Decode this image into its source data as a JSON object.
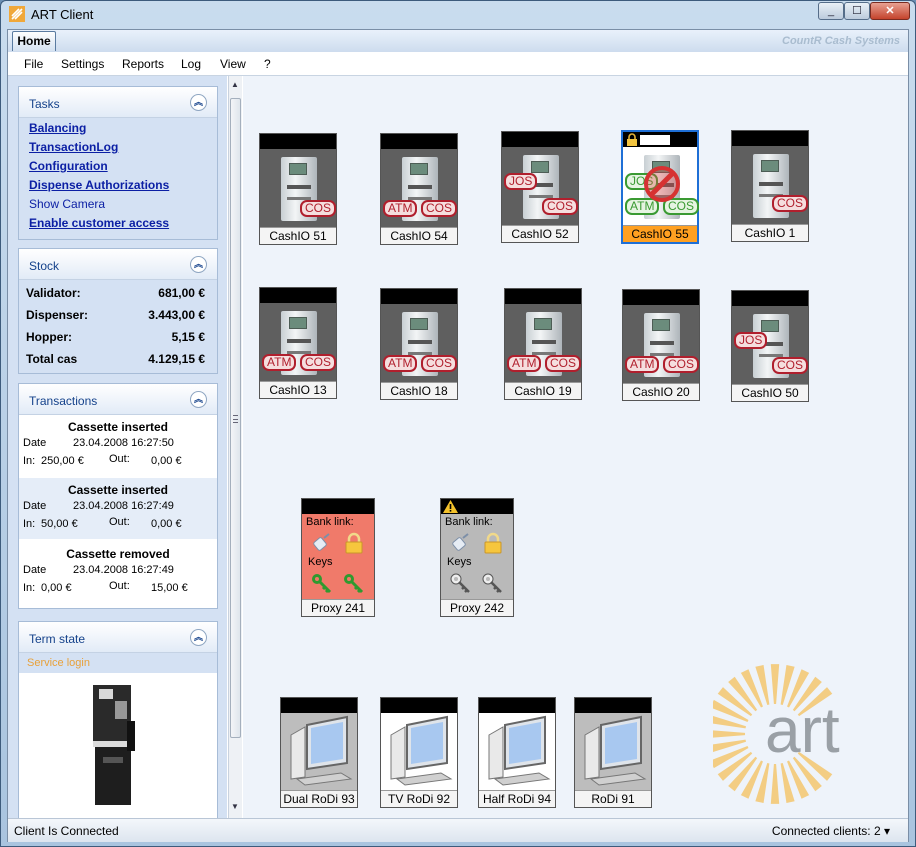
{
  "window": {
    "title": "ART Client",
    "min": "_",
    "max": "☐",
    "close": "✕"
  },
  "ribbon": {
    "home_tab": "Home",
    "brand": "CountR Cash Systems"
  },
  "menu": [
    "File",
    "Settings",
    "Reports",
    "Log",
    "View",
    "?"
  ],
  "tasks": {
    "title": "Tasks",
    "collapse": "︽",
    "items": [
      {
        "label": "Balancing",
        "style": "link"
      },
      {
        "label": "TransactionLog",
        "style": "link"
      },
      {
        "label": "Configuration",
        "style": "link"
      },
      {
        "label": "Dispense Authorizations",
        "style": "link"
      },
      {
        "label": "Show Camera",
        "style": "plain"
      },
      {
        "label": "Enable customer access",
        "style": "link"
      }
    ]
  },
  "stock": {
    "title": "Stock",
    "collapse": "︽",
    "rows": [
      {
        "label": "Validator:",
        "value": "681,00 €"
      },
      {
        "label": "Dispenser:",
        "value": "3.443,00 €"
      },
      {
        "label": "Hopper:",
        "value": "5,15 €"
      },
      {
        "label": "Total cas",
        "value": "4.129,15 €"
      }
    ]
  },
  "transactions": {
    "title": "Transactions",
    "collapse": "︽",
    "date_label": "Date",
    "in_label": "In:",
    "out_label": "Out:",
    "items": [
      {
        "title": "Cassette inserted",
        "date": "23.04.2008 16:27:50",
        "in": "250,00 €",
        "out": "0,00 €"
      },
      {
        "title": "Cassette inserted",
        "date": "23.04.2008 16:27:49",
        "in": "50,00 €",
        "out": "0,00 €"
      },
      {
        "title": "Cassette removed",
        "date": "23.04.2008 16:27:49",
        "in": "0,00 €",
        "out": "15,00 €"
      }
    ]
  },
  "term_state": {
    "title": "Term state",
    "collapse": "︽",
    "service_login": "Service login"
  },
  "tiles_row1": [
    {
      "label": "CashIO 51",
      "badges": [
        "COS"
      ]
    },
    {
      "label": "CashIO 54",
      "badges": [
        "ATM",
        "COS"
      ]
    },
    {
      "label": "CashIO 52",
      "badges": [
        "JOS",
        "COS"
      ]
    },
    {
      "label": "CashIO 55",
      "badges": [
        "JOS",
        "ATM",
        "COS"
      ],
      "selected": true
    },
    {
      "label": "CashIO 1",
      "badges": [
        "COS"
      ]
    }
  ],
  "tiles_row2": [
    {
      "label": "CashIO 13",
      "badges": [
        "ATM",
        "COS"
      ]
    },
    {
      "label": "CashIO 18",
      "badges": [
        "ATM",
        "COS"
      ]
    },
    {
      "label": "CashIO 19",
      "badges": [
        "ATM",
        "COS"
      ]
    },
    {
      "label": "CashIO 20",
      "badges": [
        "ATM",
        "COS"
      ]
    },
    {
      "label": "CashIO 50",
      "badges": [
        "JOS",
        "COS"
      ]
    }
  ],
  "proxies": [
    {
      "label": "Proxy 241",
      "bank_link": "Bank link:",
      "keys": "Keys",
      "status_color": "#f07a6a"
    },
    {
      "label": "Proxy 242",
      "bank_link": "Bank link:",
      "keys": "Keys",
      "status_color": "#b9b9b9"
    }
  ],
  "rodis": [
    {
      "label": "Dual RoDi 93"
    },
    {
      "label": "TV RoDi 92"
    },
    {
      "label": "Half RoDi 94"
    },
    {
      "label": "RoDi 91"
    }
  ],
  "logo": {
    "text": "art"
  },
  "status": {
    "left": "Client Is Connected",
    "right": "Connected clients: 2 ▾"
  },
  "colors": {
    "accent": "#15428b",
    "selected": "#ffa021",
    "alert_badge": "#b01f2d",
    "ok_badge": "#3a9a32",
    "logo_sun": "#f3c66d",
    "logo_text": "#9aa0a6"
  }
}
